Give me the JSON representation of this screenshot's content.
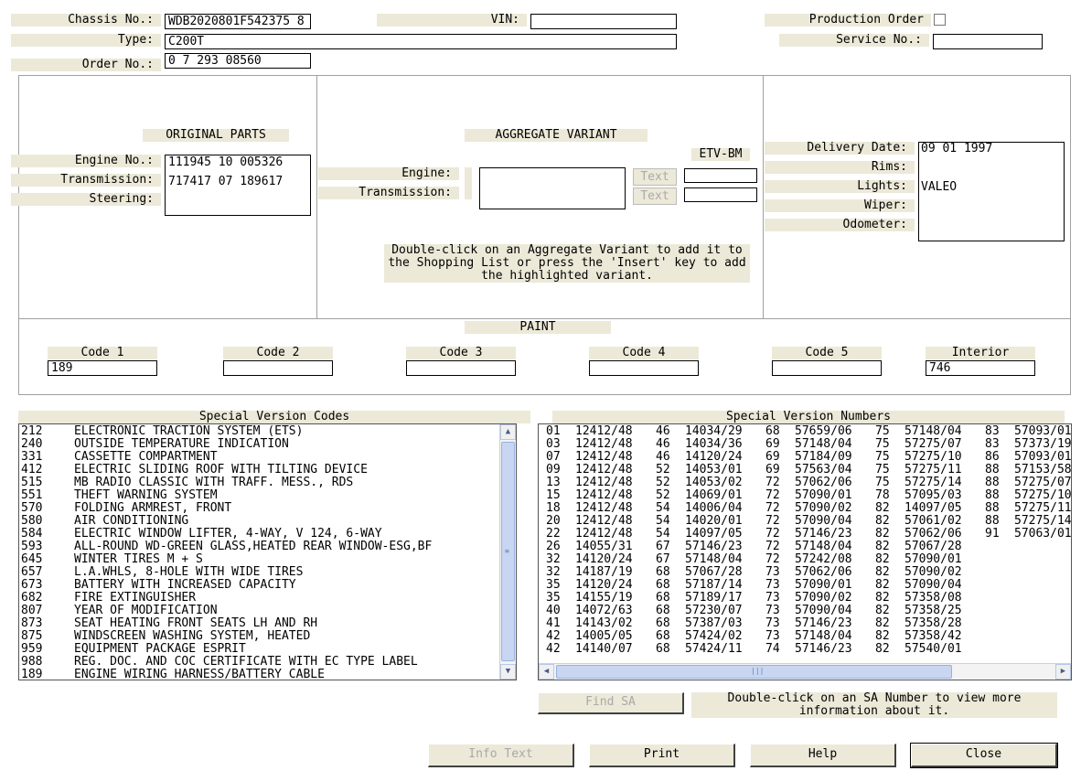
{
  "header": {
    "chassis_label": "Chassis No.:",
    "chassis_value": "WDB2020801F542375 8",
    "vin_label": "VIN:",
    "vin_value": "",
    "production_order_label": "Production Order",
    "production_order_checked": false,
    "type_label": "Type:",
    "type_value": "C200T",
    "service_label": "Service No.:",
    "service_value": "",
    "order_label": "Order No.:",
    "order_value": "0 7 293 08560"
  },
  "original_parts": {
    "title": "ORIGINAL PARTS",
    "engine_label": "Engine No.:",
    "transmission_label": "Transmission:",
    "steering_label": "Steering:",
    "engine_value": "111945 10 005326",
    "transmission_value": "717417 07 189617",
    "steering_value": ""
  },
  "aggregate": {
    "title": "AGGREGATE VARIANT",
    "etv_label": "ETV-BM",
    "engine_label": "Engine:",
    "transmission_label": "Transmission:",
    "text_button_1": "Text",
    "text_button_2": "Text",
    "etv_engine_value": "",
    "etv_transmission_value": "",
    "hint_line_1": "Double-click on an Aggregate Variant to add it to",
    "hint_line_2": "the Shopping List or press the 'Insert' key to add",
    "hint_line_3": "the highlighted variant."
  },
  "vehicle_info": {
    "delivery_label": "Delivery Date:",
    "rims_label": "Rims:",
    "lights_label": "Lights:",
    "wiper_label": "Wiper:",
    "odometer_label": "Odometer:",
    "delivery_value": "09 01 1997",
    "rims_value": "",
    "lights_value": "VALEO",
    "wiper_value": "",
    "odometer_value": ""
  },
  "paint": {
    "title": "PAINT",
    "codes": [
      {
        "label": "Code 1",
        "value": "189"
      },
      {
        "label": "Code 2",
        "value": ""
      },
      {
        "label": "Code 3",
        "value": ""
      },
      {
        "label": "Code 4",
        "value": ""
      },
      {
        "label": "Code 5",
        "value": ""
      },
      {
        "label": "Interior",
        "value": "746"
      }
    ]
  },
  "special_version_codes": {
    "title": "Special Version Codes",
    "items": [
      {
        "code": "212",
        "desc": "ELECTRONIC TRACTION SYSTEM (ETS)"
      },
      {
        "code": "240",
        "desc": "OUTSIDE TEMPERATURE INDICATION"
      },
      {
        "code": "331",
        "desc": "CASSETTE COMPARTMENT"
      },
      {
        "code": "412",
        "desc": "ELECTRIC SLIDING ROOF WITH TILTING DEVICE"
      },
      {
        "code": "515",
        "desc": "MB RADIO CLASSIC WITH TRAFF. MESS., RDS"
      },
      {
        "code": "551",
        "desc": "THEFT WARNING SYSTEM"
      },
      {
        "code": "570",
        "desc": "FOLDING ARMREST, FRONT"
      },
      {
        "code": "580",
        "desc": "AIR CONDITIONING"
      },
      {
        "code": "584",
        "desc": "ELECTRIC WINDOW LIFTER, 4-WAY, V 124, 6-WAY"
      },
      {
        "code": "593",
        "desc": "ALL-ROUND WD-GREEN GLASS,HEATED REAR WINDOW-ESG,BF"
      },
      {
        "code": "645",
        "desc": "WINTER TIRES M + S"
      },
      {
        "code": "657",
        "desc": "L.A.WHLS, 8-HOLE WITH WIDE TIRES"
      },
      {
        "code": "673",
        "desc": "BATTERY WITH INCREASED CAPACITY"
      },
      {
        "code": "682",
        "desc": "FIRE EXTINGUISHER"
      },
      {
        "code": "807",
        "desc": "YEAR OF MODIFICATION"
      },
      {
        "code": "873",
        "desc": "SEAT HEATING FRONT SEATS LH AND RH"
      },
      {
        "code": "875",
        "desc": "WINDSCREEN WASHING SYSTEM, HEATED"
      },
      {
        "code": "959",
        "desc": "EQUIPMENT PACKAGE ESPRIT"
      },
      {
        "code": "988",
        "desc": "REG. DOC. AND COC CERTIFICATE WITH EC TYPE LABEL"
      },
      {
        "code": "189",
        "desc": "ENGINE WIRING HARNESS/BATTERY CABLE"
      }
    ]
  },
  "special_version_numbers": {
    "title": "Special Version Numbers",
    "columns": [
      [
        [
          "01",
          "12412/48"
        ],
        [
          "03",
          "12412/48"
        ],
        [
          "07",
          "12412/48"
        ],
        [
          "09",
          "12412/48"
        ],
        [
          "13",
          "12412/48"
        ],
        [
          "15",
          "12412/48"
        ],
        [
          "18",
          "12412/48"
        ],
        [
          "20",
          "12412/48"
        ],
        [
          "22",
          "12412/48"
        ],
        [
          "26",
          "14055/31"
        ],
        [
          "32",
          "14120/24"
        ],
        [
          "32",
          "14187/19"
        ],
        [
          "35",
          "14120/24"
        ],
        [
          "35",
          "14155/19"
        ],
        [
          "40",
          "14072/63"
        ],
        [
          "41",
          "14143/02"
        ],
        [
          "42",
          "14005/05"
        ],
        [
          "42",
          "14140/07"
        ]
      ],
      [
        [
          "46",
          "14034/29"
        ],
        [
          "46",
          "14034/36"
        ],
        [
          "46",
          "14120/24"
        ],
        [
          "52",
          "14053/01"
        ],
        [
          "52",
          "14053/02"
        ],
        [
          "52",
          "14069/01"
        ],
        [
          "54",
          "14006/04"
        ],
        [
          "54",
          "14020/01"
        ],
        [
          "54",
          "14097/05"
        ],
        [
          "67",
          "57146/23"
        ],
        [
          "67",
          "57148/04"
        ],
        [
          "68",
          "57067/28"
        ],
        [
          "68",
          "57187/14"
        ],
        [
          "68",
          "57189/17"
        ],
        [
          "68",
          "57230/07"
        ],
        [
          "68",
          "57387/03"
        ],
        [
          "68",
          "57424/02"
        ],
        [
          "68",
          "57424/11"
        ]
      ],
      [
        [
          "68",
          "57659/06"
        ],
        [
          "69",
          "57148/04"
        ],
        [
          "69",
          "57184/09"
        ],
        [
          "69",
          "57563/04"
        ],
        [
          "72",
          "57062/06"
        ],
        [
          "72",
          "57090/01"
        ],
        [
          "72",
          "57090/02"
        ],
        [
          "72",
          "57090/04"
        ],
        [
          "72",
          "57146/23"
        ],
        [
          "72",
          "57148/04"
        ],
        [
          "72",
          "57242/08"
        ],
        [
          "73",
          "57062/06"
        ],
        [
          "73",
          "57090/01"
        ],
        [
          "73",
          "57090/02"
        ],
        [
          "73",
          "57090/04"
        ],
        [
          "73",
          "57146/23"
        ],
        [
          "73",
          "57148/04"
        ],
        [
          "74",
          "57146/23"
        ]
      ],
      [
        [
          "75",
          "57148/04"
        ],
        [
          "75",
          "57275/07"
        ],
        [
          "75",
          "57275/10"
        ],
        [
          "75",
          "57275/11"
        ],
        [
          "75",
          "57275/14"
        ],
        [
          "78",
          "57095/03"
        ],
        [
          "82",
          "14097/05"
        ],
        [
          "82",
          "57061/02"
        ],
        [
          "82",
          "57062/06"
        ],
        [
          "82",
          "57067/28"
        ],
        [
          "82",
          "57090/01"
        ],
        [
          "82",
          "57090/02"
        ],
        [
          "82",
          "57090/04"
        ],
        [
          "82",
          "57358/08"
        ],
        [
          "82",
          "57358/25"
        ],
        [
          "82",
          "57358/28"
        ],
        [
          "82",
          "57358/42"
        ],
        [
          "82",
          "57540/01"
        ]
      ],
      [
        [
          "83",
          "57093/01"
        ],
        [
          "83",
          "57373/19"
        ],
        [
          "86",
          "57093/01"
        ],
        [
          "88",
          "57153/58"
        ],
        [
          "88",
          "57275/07"
        ],
        [
          "88",
          "57275/10"
        ],
        [
          "88",
          "57275/11"
        ],
        [
          "88",
          "57275/14"
        ],
        [
          "91",
          "57063/01"
        ]
      ]
    ],
    "find_sa_label": "Find SA",
    "hint_line_1": "Double-click on an SA Number to view more",
    "hint_line_2": "information about it."
  },
  "footer": {
    "info_text_label": "Info Text",
    "print_label": "Print",
    "help_label": "Help",
    "close_label": "Close"
  },
  "icons": {
    "scroll_up": "scroll-up-arrow-icon",
    "scroll_down": "scroll-down-arrow-icon",
    "scroll_left": "scroll-left-arrow-icon",
    "scroll_right": "scroll-right-arrow-icon"
  },
  "colors": {
    "label_bg": "#ece9d8",
    "scroll_thumb": "#c8d6f2",
    "disabled_text": "#a8a8a8"
  }
}
